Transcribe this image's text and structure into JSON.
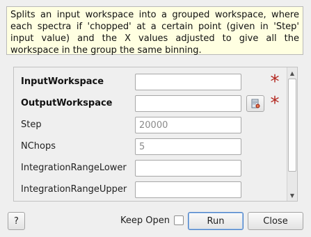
{
  "description": "Splits an input workspace into a grouped workspace, where each spectra if 'chopped' at a certain point (given in 'Step' input value) and the X values adjusted to give all the workspace in the group the same binning.",
  "properties": [
    {
      "label": "InputWorkspace",
      "value": "",
      "placeholder": "",
      "mandatory": true,
      "browse": false
    },
    {
      "label": "OutputWorkspace",
      "value": "",
      "placeholder": "",
      "mandatory": true,
      "browse": true
    },
    {
      "label": "Step",
      "value": "",
      "placeholder": "20000",
      "mandatory": false,
      "browse": false
    },
    {
      "label": "NChops",
      "value": "",
      "placeholder": "5",
      "mandatory": false,
      "browse": false
    },
    {
      "label": "IntegrationRangeLower",
      "value": "",
      "placeholder": "",
      "mandatory": false,
      "browse": false
    },
    {
      "label": "IntegrationRangeUpper",
      "value": "",
      "placeholder": "",
      "mandatory": false,
      "browse": false
    }
  ],
  "mandatory_marker": "*",
  "buttons": {
    "help": "?",
    "keep_open": "Keep Open",
    "run": "Run",
    "close": "Close"
  },
  "keep_open_checked": false,
  "colors": {
    "description_bg": "#ffffe1",
    "mandatory_star": "#b3261e",
    "default_button_border": "#4a7fc4"
  },
  "icons": {
    "browse": "workspace-browse-icon",
    "scroll_up": "scroll-up-arrow-icon",
    "scroll_down": "scroll-down-arrow-icon"
  }
}
